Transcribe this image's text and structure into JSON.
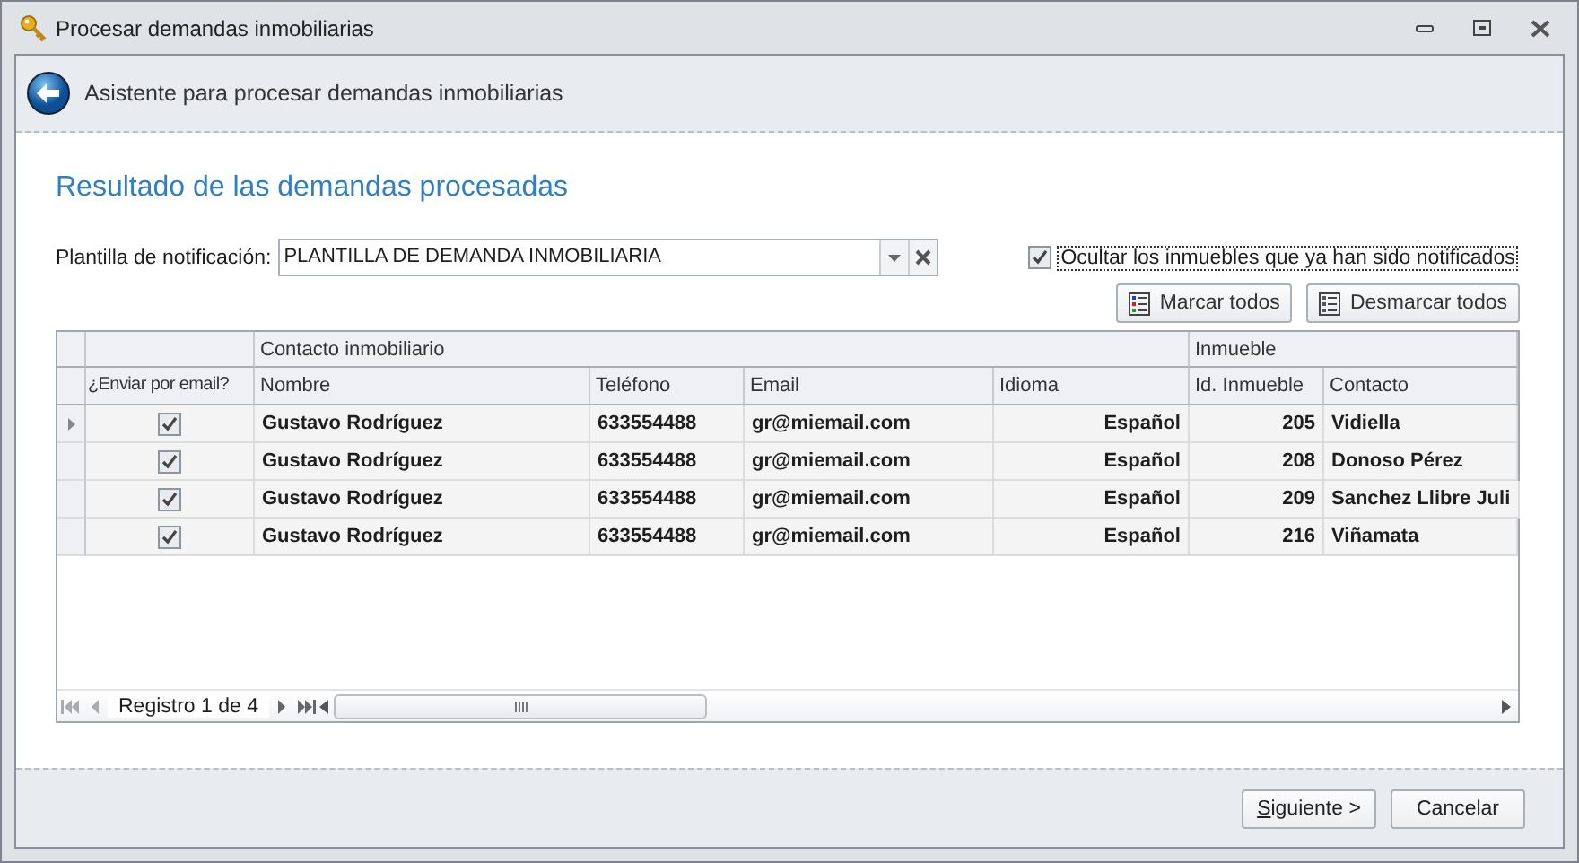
{
  "window": {
    "title": "Procesar demandas inmobiliarias"
  },
  "header": {
    "title": "Asistente para procesar demandas inmobiliarias"
  },
  "section_title": "Resultado de las demandas procesadas",
  "template": {
    "label": "Plantilla de notificación:",
    "value": "PLANTILLA DE DEMANDA INMOBILIARIA"
  },
  "hide_notified": {
    "label": "Ocultar los inmuebles que ya han sido notificados",
    "checked": true
  },
  "actions": [
    "Marcar todos",
    "Desmarcar todos"
  ],
  "table": {
    "bands": [
      {
        "label": "Contacto inmobiliario"
      },
      {
        "label": "Inmueble"
      }
    ],
    "columns": [
      "¿Enviar por email?",
      "Nombre",
      "Teléfono",
      "Email",
      "Idioma",
      "Id. Inmueble",
      "Contacto"
    ],
    "rows": [
      {
        "selected": true,
        "send": true,
        "nombre": "Gustavo Rodríguez",
        "telefono": "633554488",
        "email": "gr@miemail.com",
        "idioma": "Español",
        "id": "205",
        "contacto": "Vidiella"
      },
      {
        "selected": false,
        "send": true,
        "nombre": "Gustavo Rodríguez",
        "telefono": "633554488",
        "email": "gr@miemail.com",
        "idioma": "Español",
        "id": "208",
        "contacto": "Donoso Pérez"
      },
      {
        "selected": false,
        "send": true,
        "nombre": "Gustavo Rodríguez",
        "telefono": "633554488",
        "email": "gr@miemail.com",
        "idioma": "Español",
        "id": "209",
        "contacto": "Sanchez Llibre Juli"
      },
      {
        "selected": false,
        "send": true,
        "nombre": "Gustavo Rodríguez",
        "telefono": "633554488",
        "email": "gr@miemail.com",
        "idioma": "Español",
        "id": "216",
        "contacto": "Viñamata"
      }
    ],
    "navigator": "Registro 1 de 4"
  },
  "buttons": [
    "Siguiente >",
    "Cancelar"
  ]
}
